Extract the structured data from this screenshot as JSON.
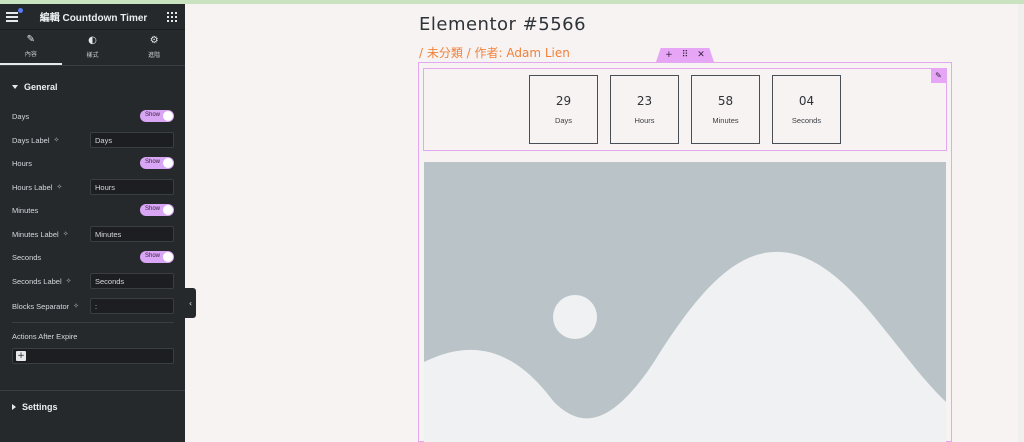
{
  "sidebar": {
    "title": "編輯 Countdown Timer",
    "tabs": [
      {
        "label": "內容",
        "icon": "pencil-icon"
      },
      {
        "label": "樣式",
        "icon": "contrast-icon"
      },
      {
        "label": "進階",
        "icon": "gear-icon"
      }
    ],
    "general_title": "General",
    "toggle_text": "Show",
    "days_label": "Days",
    "days_field_label": "Days Label",
    "days_value": "Days",
    "hours_label": "Hours",
    "hours_field_label": "Hours Label",
    "hours_value": "Hours",
    "minutes_label": "Minutes",
    "minutes_field_label": "Minutes Label",
    "minutes_value": "Minutes",
    "seconds_label": "Seconds",
    "seconds_field_label": "Seconds Label",
    "seconds_value": "Seconds",
    "separator_label": "Blocks Separator",
    "separator_value": ":",
    "actions_label": "Actions After Expire",
    "settings_title": "Settings"
  },
  "canvas": {
    "page_title": "Elementor #5566",
    "meta": "/ 未分類 / 作者: Adam Lien",
    "countdown": [
      {
        "number": "29",
        "label": "Days"
      },
      {
        "number": "23",
        "label": "Hours"
      },
      {
        "number": "58",
        "label": "Minutes"
      },
      {
        "number": "04",
        "label": "Seconds"
      }
    ]
  },
  "colors": {
    "sidebar_bg": "#26292c",
    "accent_pink": "#e6a6f5",
    "meta_orange": "#f0823c",
    "canvas_bg": "#f7f3f2",
    "placeholder_gray": "#bac4c8"
  }
}
